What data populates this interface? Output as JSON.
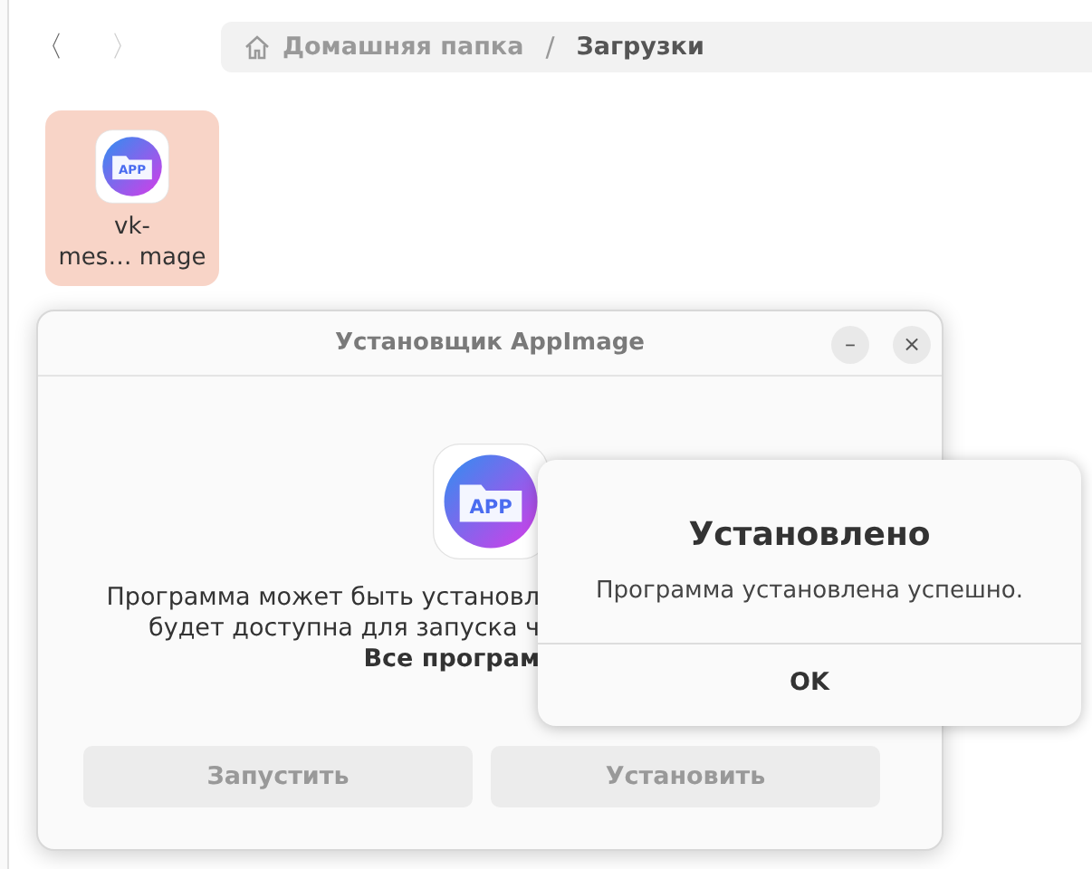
{
  "file_manager": {
    "nav": [
      {
        "label": "〈",
        "disabled": false
      },
      {
        "label": "〉",
        "disabled": true
      }
    ],
    "path": [
      {
        "label": "Домашняя папка",
        "current": false,
        "home": true
      },
      {
        "label": "Загрузки",
        "current": true,
        "home": false
      }
    ],
    "separator": "/",
    "files": [
      {
        "name_lines": [
          "vk-",
          "mes… mage"
        ],
        "icon_label": "APP",
        "selected": true
      }
    ]
  },
  "installer": {
    "title": "Установщик AppImage",
    "minimize": "–",
    "close": "×",
    "icon_label": "APP",
    "message_lines": [
      {
        "text": "Программа может быть установл",
        "bold": false
      },
      {
        "text": "будет доступна для запуска ч",
        "bold": false
      },
      {
        "text": "Все програм",
        "bold": true
      }
    ],
    "buttons": [
      {
        "label": "Запустить",
        "disabled": true
      },
      {
        "label": "Установить",
        "disabled": true
      }
    ]
  },
  "alert": {
    "title": "Установлено",
    "message": "Программа установлена успешно.",
    "button": "OK"
  }
}
